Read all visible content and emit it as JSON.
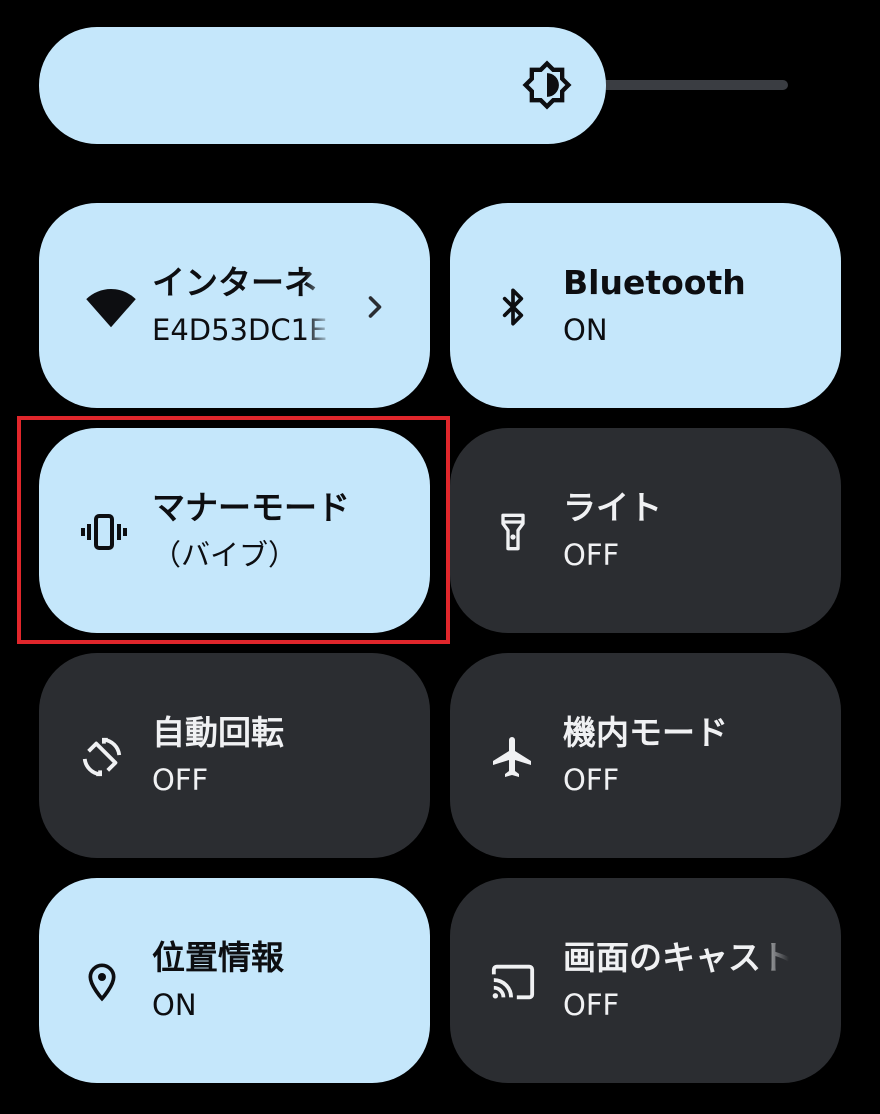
{
  "brightness": {
    "level": 0.72,
    "icon": "brightness-auto-icon"
  },
  "tiles": [
    {
      "title": "インターネ",
      "subtitle": "E4D53DC1E",
      "state": "on",
      "icon": "wifi-icon",
      "has_chevron": true
    },
    {
      "title": "Bluetooth",
      "subtitle": "ON",
      "state": "on",
      "icon": "bluetooth-icon",
      "has_chevron": false
    },
    {
      "title": "マナーモード",
      "subtitle": "（バイブ）",
      "state": "on",
      "icon": "vibrate-icon",
      "has_chevron": false,
      "highlighted": true
    },
    {
      "title": "ライト",
      "subtitle": "OFF",
      "state": "off",
      "icon": "flashlight-icon",
      "has_chevron": false
    },
    {
      "title": "自動回転",
      "subtitle": "OFF",
      "state": "off",
      "icon": "auto-rotate-icon",
      "has_chevron": false
    },
    {
      "title": "機内モード",
      "subtitle": "OFF",
      "state": "off",
      "icon": "airplane-icon",
      "has_chevron": false
    },
    {
      "title": "位置情報",
      "subtitle": "ON",
      "state": "on",
      "icon": "location-icon",
      "has_chevron": false
    },
    {
      "title": "画面のキャスト",
      "subtitle": "OFF",
      "state": "off",
      "icon": "cast-icon",
      "has_chevron": false
    }
  ],
  "colors": {
    "tile_on": "#c5e7fb",
    "tile_off": "#2b2d31",
    "highlight": "#e0262b"
  }
}
